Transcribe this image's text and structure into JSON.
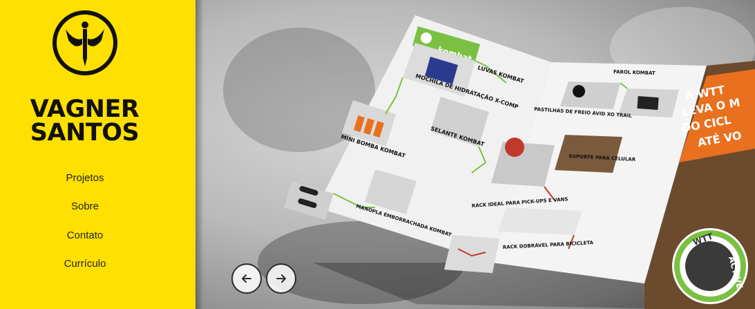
{
  "brand": {
    "line1": "VAGNER",
    "line2": "SANTOS"
  },
  "nav": [
    {
      "label": "Projetos"
    },
    {
      "label": "Sobre"
    },
    {
      "label": "Contato"
    },
    {
      "label": "Currículo"
    }
  ],
  "slider": {
    "prev_icon": "arrow-left-icon",
    "next_icon": "arrow-right-icon"
  },
  "brochure": {
    "logo_text": "kombat",
    "headings": [
      "MOCHILA DE HIDRATAÇÃO X-COMP",
      "LUVAS KOMBAT",
      "MINI BOMBA KOMBAT",
      "SELANTE KOMBAT",
      "MANOPLA EMBORRACHADA KOMBAT",
      "PASTILHAS DE FREIO AVID XO TRAIL",
      "FAROL KOMBAT",
      "SUPORTE PARA CELULAR",
      "RACK IDEAL PARA PICK-UPS E VANS",
      "RACK DOBRÁVEL PARA BICICLETA"
    ],
    "cover_lines": [
      "A WTT",
      "LEVA O M",
      "DO CICL",
      "ATÉ VO"
    ],
    "seal": [
      "WTT",
      "ACTIVE"
    ]
  },
  "colors": {
    "sidebar": "#FFE000",
    "accent_green": "#7AC143",
    "cover_orange": "#E8701F",
    "text_dark": "#111111"
  }
}
